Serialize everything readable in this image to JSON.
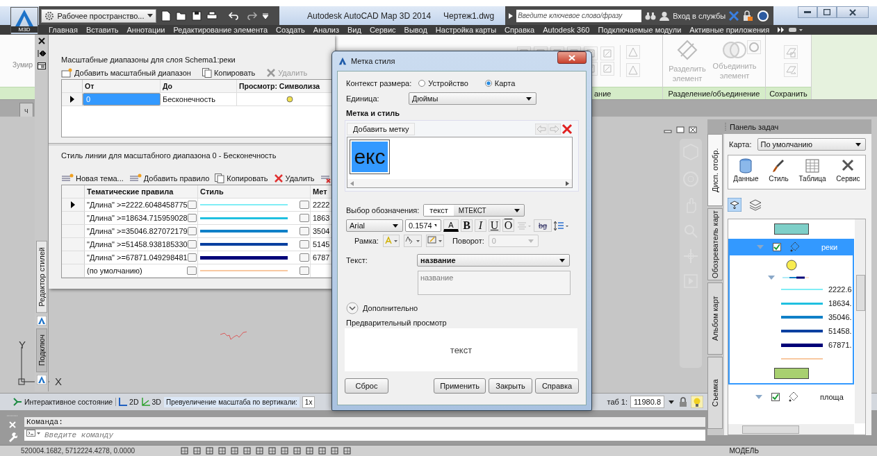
{
  "app": {
    "badge": "M3D",
    "workspace": "Рабочее пространство...",
    "title": "Autodesk AutoCAD Map 3D 2014",
    "document": "Чертеж1.dwg",
    "search": {
      "placeholder": "Введите ключевое слово/фразу"
    },
    "signin": "Вход в службы"
  },
  "ribbon_tabs": [
    "Главная",
    "Вставить",
    "Аннотации",
    "Редактирование элемента",
    "Создать",
    "Анализ",
    "Вид",
    "Сервис",
    "Вывод",
    "Настройка карты",
    "Справка",
    "Autodesk 360",
    "Подключаемые модули",
    "Активные приложения"
  ],
  "ribbon": {
    "left_button": "Зумир",
    "panels": [
      {
        "title": "ание",
        "kind": "grid"
      },
      {
        "title": "Разделение/объединение",
        "kind": "large",
        "buttons": [
          {
            "label": "Разделить элемент",
            "disabled": true
          },
          {
            "label": "Объединить элемент",
            "disabled": true
          }
        ]
      },
      {
        "title": "Сохранить",
        "kind": "stack"
      }
    ]
  },
  "file_tabs": [
    "ч"
  ],
  "canvas": {
    "ucs": {
      "x": "X",
      "y": "Y"
    }
  },
  "style_editor": {
    "side_tabs": [
      {
        "label": "Редактор стилей",
        "selected": true
      },
      {
        "label": "Подключ",
        "selected": false
      }
    ],
    "scale_ranges": {
      "title": "Масштабные диапазоны для слоя Schema1:реки",
      "toolbar": [
        {
          "label": "Добавить масштабный диапазон",
          "kind": "add",
          "disabled": false
        },
        {
          "label": "Копировать",
          "kind": "copy",
          "disabled": false
        },
        {
          "label": "Удалить",
          "kind": "delete",
          "disabled": true
        }
      ],
      "columns": [
        "От",
        "До",
        "Просмотр: Символиза"
      ],
      "rows": [
        {
          "from": "0",
          "to": "Бесконечность",
          "color": "#f0e050",
          "selected": true
        }
      ]
    },
    "line_style": {
      "title": "Стиль линии для масштабного диапазона 0 - Бесконечность",
      "toolbar": [
        {
          "label": "Новая тема...",
          "kind": "add",
          "disabled": false
        },
        {
          "label": "Добавить правило",
          "kind": "add",
          "disabled": false
        },
        {
          "label": "Копировать",
          "kind": "copy",
          "disabled": false
        },
        {
          "label": "Удалить",
          "kind": "delete",
          "disabled": false
        }
      ],
      "columns": [
        "Тематические правила",
        "Стиль",
        "Мет"
      ],
      "rows": [
        {
          "rule": "\"Длина\" >=2222.6048458775",
          "color": "#80eef6",
          "label": "2222",
          "selected": true
        },
        {
          "rule": "\"Длина\" >=18634.715959028",
          "color": "#20c0e0",
          "label": "1863",
          "selected": false
        },
        {
          "rule": "\"Длина\" >=35046.827072179",
          "color": "#1080c8",
          "label": "3504",
          "selected": false
        },
        {
          "rule": "\"Длина\" >=51458.938185330",
          "color": "#0840a0",
          "label": "5145",
          "selected": false
        },
        {
          "rule": "\"Длина\" >=67871.049298481",
          "color": "#000078",
          "label": "6787",
          "selected": false
        },
        {
          "rule": "(по умолчанию)",
          "color": "#f8c8a0",
          "selected": false
        }
      ]
    }
  },
  "dialog": {
    "title": "Метка стиля",
    "size_context": {
      "label": "Контекст размера:",
      "options": [
        {
          "label": "Устройство",
          "selected": false
        },
        {
          "label": "Карта",
          "selected": true
        }
      ]
    },
    "unit": {
      "label": "Единица:",
      "value": "Дюймы"
    },
    "section": "Метка и стиль",
    "add_label": "Добавить метку",
    "label_sample": "екс",
    "symbol": {
      "label": "Выбор обозначения:",
      "tokens": [
        "текст",
        "МТЕКСТ"
      ]
    },
    "font": "Arial",
    "size": "0.1574",
    "font_color": "A",
    "format": [
      {
        "label": "B",
        "kind": "bold"
      },
      {
        "label": "I",
        "kind": "italic"
      },
      {
        "label": "U",
        "kind": "underline"
      },
      {
        "label": "O",
        "kind": "overline"
      }
    ],
    "background": "bg",
    "frame": {
      "label": "Рамка:"
    },
    "rotation": {
      "label": "Поворот:",
      "value": "0",
      "disabled": true
    },
    "text": {
      "label": "Текст:",
      "value": "название",
      "expression": "название"
    },
    "more": "Дополнительно",
    "preview": {
      "label": "Предварительный просмотр",
      "text": "текст"
    },
    "buttons": [
      {
        "label": "Сброс",
        "kind": "left"
      },
      {
        "label": "Применить",
        "kind": "right"
      },
      {
        "label": "Закрыть",
        "kind": "right"
      },
      {
        "label": "Справка",
        "kind": "right"
      }
    ]
  },
  "task_pane": {
    "title": "Панель задач",
    "side_tabs": [
      {
        "label": "Дисп. отобр.",
        "selected": true
      },
      {
        "label": "Обозреватель карт",
        "selected": false
      },
      {
        "label": "Альбом карт",
        "selected": false
      },
      {
        "label": "Съемка",
        "selected": false
      }
    ],
    "map": {
      "label": "Карта:",
      "value": "По умолчанию"
    },
    "tools": [
      {
        "label": "Данные",
        "kind": "data"
      },
      {
        "label": "Стиль",
        "kind": "style"
      },
      {
        "label": "Таблица",
        "kind": "table"
      },
      {
        "label": "Сервис",
        "kind": "service"
      }
    ],
    "swatch_above": {
      "color": "#7ecfc8"
    },
    "layers": [
      {
        "name": "реки",
        "checked": true,
        "selected": true,
        "legend": [
          {
            "kind": "point",
            "color": "#f8ec50"
          },
          {
            "kind": "group"
          },
          {
            "kind": "line",
            "color": "#80eef6",
            "label": "2222.6"
          },
          {
            "kind": "line",
            "color": "#20c0e0",
            "label": "18634."
          },
          {
            "kind": "line",
            "color": "#1080c8",
            "label": "35046."
          },
          {
            "kind": "line",
            "color": "#0840a0",
            "label": "51458."
          },
          {
            "kind": "line",
            "color": "#000078",
            "label": "67871."
          },
          {
            "kind": "line",
            "color": "#f8c8a0"
          },
          {
            "kind": "area",
            "color": "#a8d070"
          }
        ]
      },
      {
        "name": "площа",
        "checked": true,
        "selected": false
      }
    ]
  },
  "status_bar": {
    "items": [
      {
        "label": "Интерактивное состояние",
        "kind": "state"
      },
      {
        "label": "2D",
        "kind": "plan"
      },
      {
        "label": "3D",
        "kind": "perspective"
      },
      {
        "label": "Превуеличение масштаба по вертикали:",
        "kind": "field"
      },
      {
        "label": "1x",
        "kind": "value"
      }
    ],
    "scale_label": "таб 1:",
    "scale_value": "11980.8"
  },
  "command": {
    "history": "Команда:",
    "placeholder": "Введите команду"
  },
  "bottom_bar": {
    "coordinates": "520004.1682, 5712224.4278, 0.0000",
    "space": "МОДЕЛЬ"
  }
}
